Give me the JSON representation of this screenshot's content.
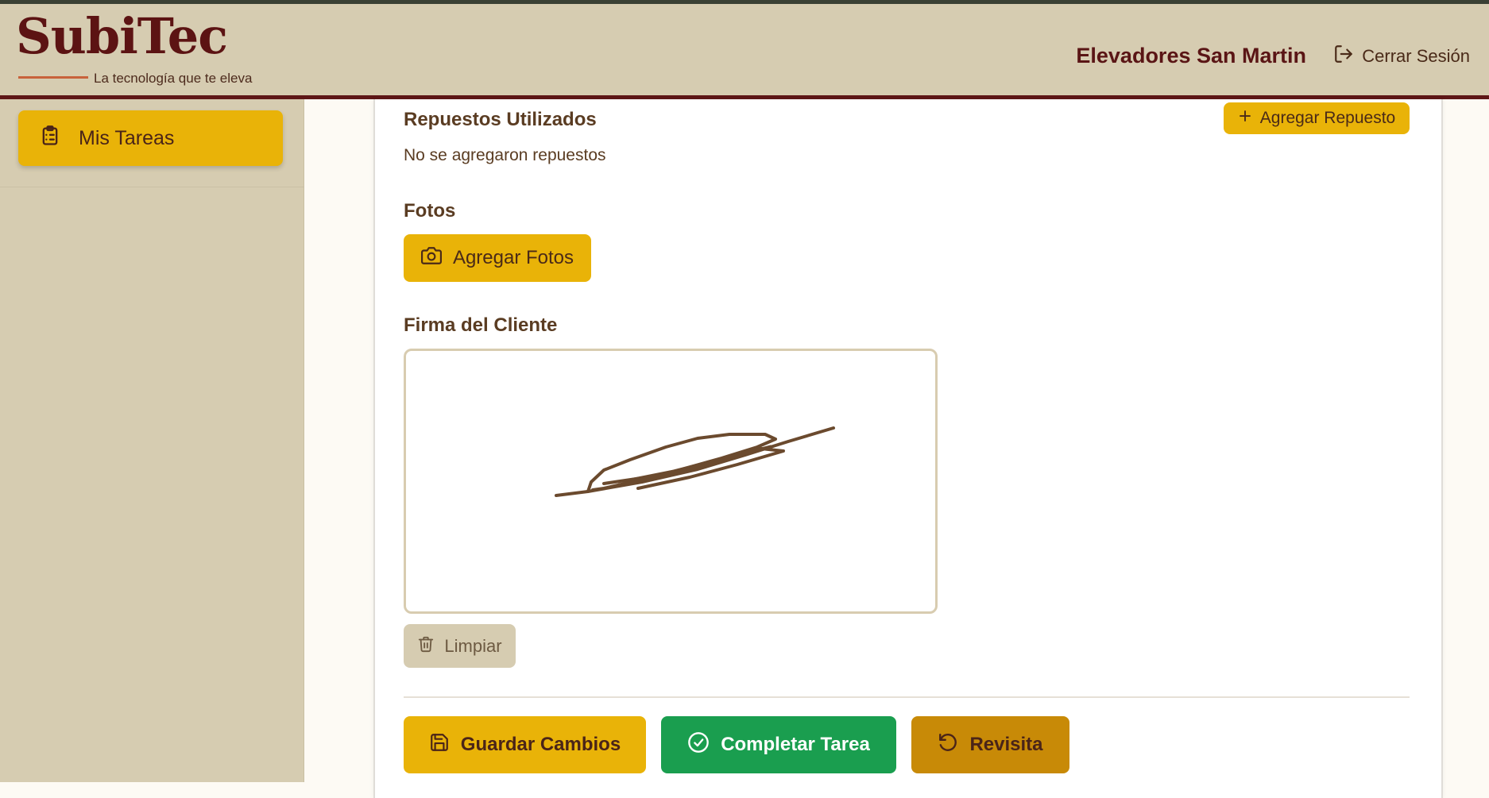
{
  "brand": {
    "title": "SubiTec",
    "tagline": "La tecnología que te eleva"
  },
  "header": {
    "company": "Elevadores San Martin",
    "logout_label": "Cerrar Sesión"
  },
  "sidebar": {
    "items": [
      {
        "label": "Mis Tareas",
        "icon": "clipboard-list-icon",
        "active": true
      }
    ]
  },
  "parts": {
    "title": "Repuestos Utilizados",
    "add_label": "Agregar Repuesto",
    "empty_text": "No se agregaron repuestos"
  },
  "photos": {
    "title": "Fotos",
    "add_label": "Agregar Fotos"
  },
  "signature": {
    "title": "Firma del Cliente",
    "clear_label": "Limpiar"
  },
  "actions": {
    "save_label": "Guardar Cambios",
    "complete_label": "Completar Tarea",
    "revisit_label": "Revisita"
  },
  "colors": {
    "brand": "#5c1313",
    "accent": "#e9b308",
    "success": "#1a9e4f",
    "warning": "#c88a07",
    "sidebar_bg": "#d6ccb1"
  }
}
